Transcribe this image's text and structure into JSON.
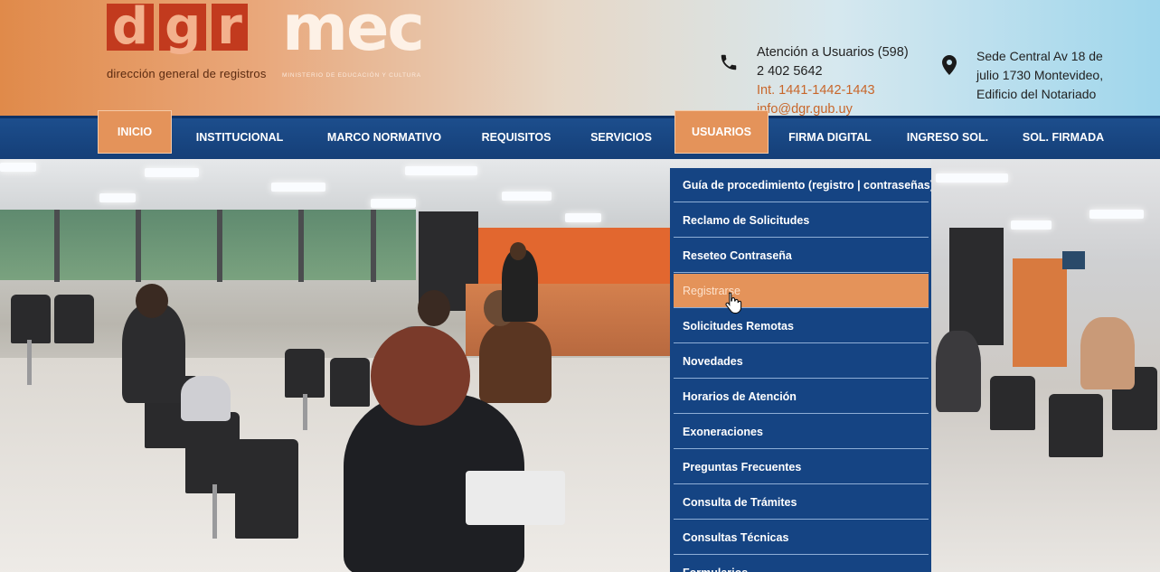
{
  "header": {
    "logo_dgr": {
      "letters": [
        "d",
        "g",
        "r"
      ],
      "subtitle": "dirección general de registros"
    },
    "logo_mec": {
      "text": "mec",
      "subtitle": "MINISTERIO DE EDUCACIÓN Y CULTURA"
    },
    "contact": {
      "icon": "phone-icon",
      "line1": "Atención a Usuarios (598)",
      "line2": "2 402 5642",
      "line3": "Int. 1441-1442-1443",
      "line4": "info@dgr.gub.uy"
    },
    "address": {
      "icon": "map-pin-icon",
      "line1": "Sede Central Av 18 de",
      "line2": "julio 1730 Montevideo,",
      "line3": "Edificio del Notariado"
    }
  },
  "nav": {
    "items": [
      {
        "label": "INICIO",
        "active": true
      },
      {
        "label": "INSTITUCIONAL"
      },
      {
        "label": "MARCO NORMATIVO"
      },
      {
        "label": "REQUISITOS"
      },
      {
        "label": "SERVICIOS"
      },
      {
        "label": "USUARIOS",
        "active": true
      },
      {
        "label": "FIRMA DIGITAL"
      },
      {
        "label": "INGRESO SOL."
      },
      {
        "label": "SOL. FIRMADA"
      }
    ]
  },
  "dropdown": {
    "items": [
      {
        "label": "Guía de procedimiento (registro | contraseñas)"
      },
      {
        "label": "Reclamo de Solicitudes"
      },
      {
        "label": "Reseteo Contraseña"
      },
      {
        "label": "Registrarse",
        "hover": true
      },
      {
        "label": "Solicitudes Remotas"
      },
      {
        "label": "Novedades"
      },
      {
        "label": "Horarios de Atención"
      },
      {
        "label": "Exoneraciones"
      },
      {
        "label": "Preguntas Frecuentes"
      },
      {
        "label": "Consulta de Trámites"
      },
      {
        "label": "Consultas Técnicas"
      },
      {
        "label": "Formularios"
      }
    ]
  },
  "colors": {
    "nav_blue": "#1d4f8e",
    "accent_orange": "#e4935a",
    "dgr_red": "#c23a1e",
    "contact_orange": "#c8662a"
  }
}
